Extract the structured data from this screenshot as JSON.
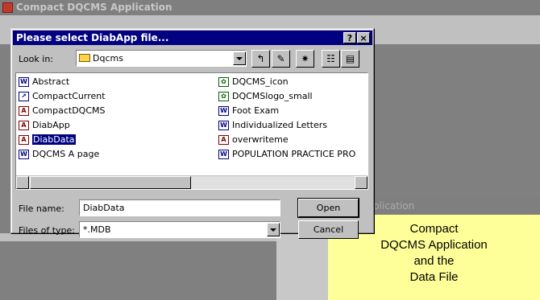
{
  "app": {
    "title": "Compact DQCMS Application",
    "sub_window_title": "plication",
    "note_lines": [
      "Compact",
      "DQCMS Application",
      "and the",
      "Data File"
    ]
  },
  "dialog": {
    "title": "Please select DiabApp file...",
    "help_button": "?",
    "close_button": "×",
    "look_in_label": "Look in:",
    "look_in_value": "Dqcms",
    "file_name_label": "File name:",
    "file_name_value": "DiabData",
    "files_of_type_label": "Files of type:",
    "files_of_type_value": "*.MDB",
    "open_label": "Open",
    "cancel_label": "Cancel"
  },
  "files": {
    "left": [
      {
        "name": "Abstract",
        "icon": "word-doc-icon"
      },
      {
        "name": "CompactCurrent",
        "icon": "shortcut-icon"
      },
      {
        "name": "CompactDQCMS",
        "icon": "access-db-icon"
      },
      {
        "name": "DiabApp",
        "icon": "access-db-icon"
      },
      {
        "name": "DiabData",
        "icon": "access-db-icon",
        "selected": true
      },
      {
        "name": "DQCMS A page",
        "icon": "word-doc-icon"
      }
    ],
    "right": [
      {
        "name": "DQCMS_icon",
        "icon": "image-icon"
      },
      {
        "name": "DQCMSlogo_small",
        "icon": "image-icon"
      },
      {
        "name": "Foot Exam",
        "icon": "word-doc-icon"
      },
      {
        "name": "Individualized Letters",
        "icon": "word-doc-icon"
      },
      {
        "name": "overwriteme",
        "icon": "access-db-icon"
      },
      {
        "name": "POPULATION PRACTICE PRO",
        "icon": "word-doc-icon"
      }
    ]
  },
  "colors": {
    "dialog_title_bg": "#000080",
    "selection_bg": "#000080",
    "note_bg": "#ffff99",
    "window_bg": "#c0c0c0"
  }
}
